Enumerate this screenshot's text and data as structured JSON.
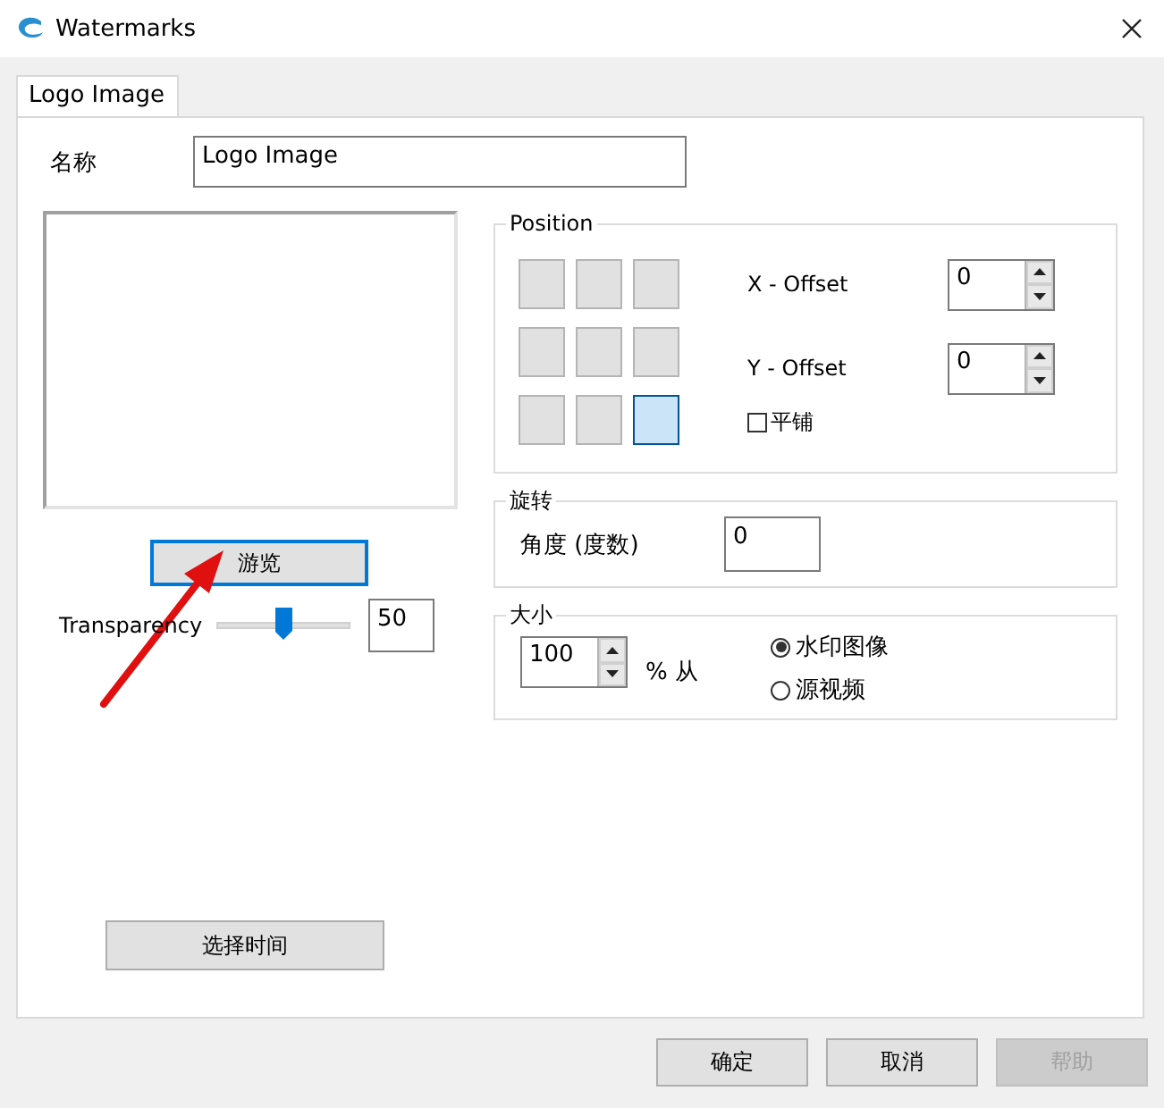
{
  "window": {
    "title": "Watermarks"
  },
  "tabs": [
    {
      "label": "Logo Image",
      "selected": true
    }
  ],
  "name": {
    "label": "名称",
    "value": "Logo Image"
  },
  "browse_button": "游览",
  "transparency": {
    "label": "Transparency",
    "level": 0.5,
    "value": "50"
  },
  "select_time_button": "选择时间",
  "position": {
    "title": "Position",
    "cells": [
      {
        "selected": false
      },
      {
        "selected": false
      },
      {
        "selected": false
      },
      {
        "selected": false
      },
      {
        "selected": false
      },
      {
        "selected": false
      },
      {
        "selected": false
      },
      {
        "selected": false
      },
      {
        "selected": true
      }
    ],
    "x_offset": {
      "label": "X - Offset",
      "value": "0"
    },
    "y_offset": {
      "label": "Y - Offset",
      "value": "0"
    },
    "tile": {
      "label": "平铺",
      "checked": false
    }
  },
  "rotation": {
    "title": "旋转",
    "label": "角度 (度数)",
    "value": "0"
  },
  "size": {
    "title": "大小",
    "value": "100",
    "unit": "% 从",
    "options": [
      {
        "label": "水印图像",
        "selected": true
      },
      {
        "label": "源视频",
        "selected": false
      }
    ]
  },
  "buttons": [
    {
      "label": "确定",
      "disabled": false
    },
    {
      "label": "取消",
      "disabled": false
    },
    {
      "label": "帮助",
      "disabled": true
    }
  ]
}
